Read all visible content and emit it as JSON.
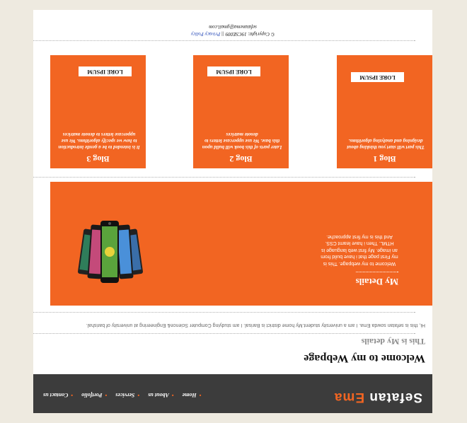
{
  "brand": {
    "part1": "Sefatan",
    "part2": "Ema"
  },
  "nav": [
    "Home",
    "About us",
    "Services",
    "Portfolio",
    "Contact us"
  ],
  "welcome": "Welcome to my Webpage",
  "subtitle": "This is My details",
  "intro": "Hi, this is sefatan sowda Ema. I am a university student.My home district is Barisal. I am studying Computer Science& Engineering at university of barishal.",
  "details": {
    "title": "My Details",
    "text": "Welcome to my webpage. This is my First page that i have build from an image. My first web language is HTML. Then i have learnt CSS. And this is my first approache."
  },
  "blogs": [
    {
      "title": "Blog 1",
      "text": "This part will start you thinking about designing and analyzing algorithms.",
      "button": "LORE IPSUM"
    },
    {
      "title": "Blog 2",
      "text": "Later parts of this book will build upon this base. We use uppercase letters to denote matrices",
      "button": "LORE IPSUM"
    },
    {
      "title": "Blog 3",
      "text": "It is intended to be a gentle introduction to how we specify algorithms. We use uppercase letters to denote matrices",
      "button": "LORE IPSUM"
    }
  ],
  "footer": {
    "copyright": "© Copyright: 19CSE009 ||",
    "privacy": "Privacy Policy",
    "email": "sefatanema@gmail.com"
  }
}
